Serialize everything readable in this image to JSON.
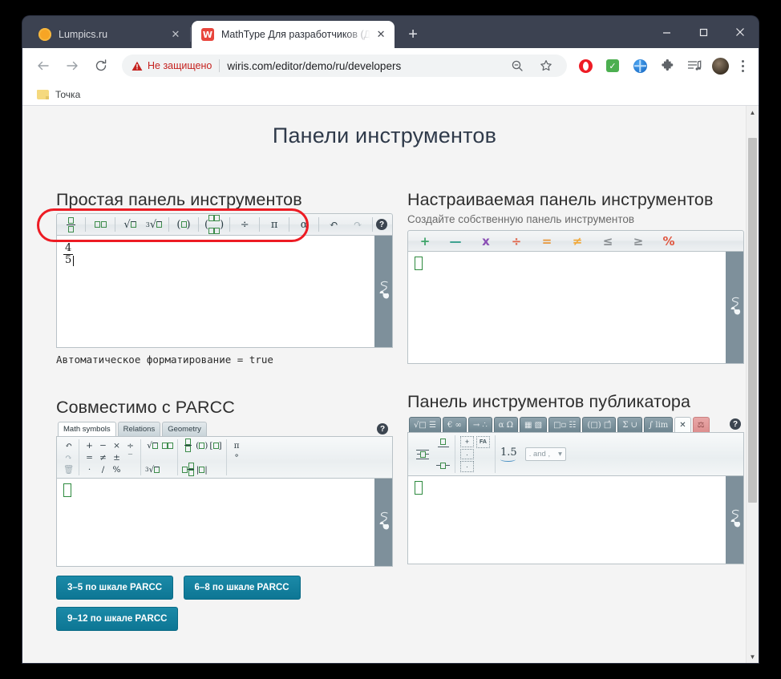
{
  "browser": {
    "tabs": [
      {
        "title": "Lumpics.ru",
        "favicon": "orange-circle-icon",
        "active": false,
        "close_label": "✕"
      },
      {
        "title": "MathType Для разработчиков (Д",
        "favicon": "mathtype-icon",
        "active": true,
        "close_label": "✕"
      }
    ],
    "new_tab_label": "+",
    "window_controls": {
      "minimize": "—",
      "maximize": "□",
      "close": "✕"
    },
    "nav": {
      "back": "←",
      "forward": "→",
      "reload": "⟳"
    },
    "omnibox": {
      "security_label": "Не защищено",
      "url": "wiris.com/editor/demo/ru/developers",
      "zoom_icon": "zoom-out-icon",
      "bookmark_icon": "star-icon"
    },
    "extensions": [
      "opera-icon",
      "adblock-check-icon",
      "globe-icon",
      "puzzle-icon",
      "playlist-icon"
    ],
    "profile": "avatar",
    "menu": "kebab-menu-icon",
    "bookmarks": [
      {
        "label": "Точка",
        "icon": "folder-icon"
      }
    ]
  },
  "page": {
    "title": "Панели инструментов",
    "help_label": "?",
    "sections": {
      "simple": {
        "heading": "Простая панель инструментов",
        "toolbar_items": [
          "fraction-icon",
          "superscript-icon",
          "square-root-icon",
          "nth-root-icon",
          "parenthesis-icon",
          "matrix-icon",
          "division-icon",
          "pi-icon",
          "alpha-icon",
          "undo-icon",
          "redo-icon"
        ],
        "pi_label": "π",
        "alpha_label": "α",
        "division_label": "÷",
        "undo_label": "↶",
        "redo_label": "↷",
        "formula_numerator": "4",
        "formula_denominator": "5",
        "caption": "Автоматическое форматирование = true"
      },
      "custom": {
        "heading": "Настраиваемая панель инструментов",
        "subheading": "Создайте собственную панель инструментов",
        "buttons": [
          {
            "label": "+",
            "name": "plus-icon",
            "color": "#3fa46a"
          },
          {
            "label": "—",
            "name": "minus-icon",
            "color": "#3aa08e"
          },
          {
            "label": "x",
            "name": "times-icon",
            "color": "#8b4fb5"
          },
          {
            "label": "÷",
            "name": "divide-icon",
            "color": "#e0654a"
          },
          {
            "label": "=",
            "name": "equals-icon",
            "color": "#e8973a"
          },
          {
            "label": "≠",
            "name": "not-equals-icon",
            "color": "#f0a93c"
          },
          {
            "label": "≤",
            "name": "less-equal-icon",
            "color": "#8a8f93"
          },
          {
            "label": "≥",
            "name": "greater-equal-icon",
            "color": "#8a8f93"
          },
          {
            "label": "%",
            "name": "percent-icon",
            "color": "#e0563f"
          }
        ]
      },
      "parcc": {
        "heading": "Совместимо с PARCC",
        "tabs": [
          {
            "label": "Math symbols",
            "active": true
          },
          {
            "label": "Relations",
            "active": false
          },
          {
            "label": "Geometry",
            "active": false
          }
        ],
        "groups": [
          [
            "↶",
            "↷",
            "Ὕ1",
            "+",
            "=",
            "·",
            "−",
            "≠",
            "/",
            "×",
            "±",
            "%",
            "÷",
            "−",
            ""
          ],
          [
            "sqrt-icon",
            "",
            "cbrt-icon",
            "superscript-icon",
            "",
            ""
          ],
          [
            "fraction-icon",
            "",
            "mixed-fraction-icon",
            "paren-icon",
            "",
            "abs-icon",
            "bracket-icon",
            "",
            ""
          ],
          [
            "π",
            "",
            "°"
          ]
        ],
        "buttons": [
          "3–5 по шкале PARCC",
          "6–8 по шкале PARCC",
          "9–12 по шкале PARCC"
        ]
      },
      "publisher": {
        "heading": "Панель инструментов публикатора",
        "tabs": [
          {
            "label": "√□ ☰",
            "name": "tab-general",
            "active": false
          },
          {
            "label": "€ ∞",
            "name": "tab-sets",
            "active": false
          },
          {
            "label": "→ ∴",
            "name": "tab-arrows",
            "active": false
          },
          {
            "label": "α Ω",
            "name": "tab-greek",
            "active": false
          },
          {
            "label": "▦ ▧",
            "name": "tab-matrices",
            "active": false
          },
          {
            "label": "□▫ ☷",
            "name": "tab-scripts",
            "active": false
          },
          {
            "label": "(□) □̂",
            "name": "tab-accents",
            "active": false
          },
          {
            "label": "Σ ∪",
            "name": "tab-operators",
            "active": false
          },
          {
            "label": "∫ lim",
            "name": "tab-calculus",
            "active": false
          },
          {
            "label": "✕",
            "name": "tab-editing",
            "active": true
          },
          {
            "label": "",
            "name": "tab-chemistry",
            "active": false,
            "pink": true
          }
        ],
        "row_items": {
          "align_icons": [
            "align-center-icon",
            "align-top-icon",
            "align-middle-icon"
          ],
          "plus_label": "+",
          "fa_label": "FA",
          "number": "1.5",
          "select_value": ". and ,",
          "select_caret": "▾"
        }
      }
    }
  }
}
